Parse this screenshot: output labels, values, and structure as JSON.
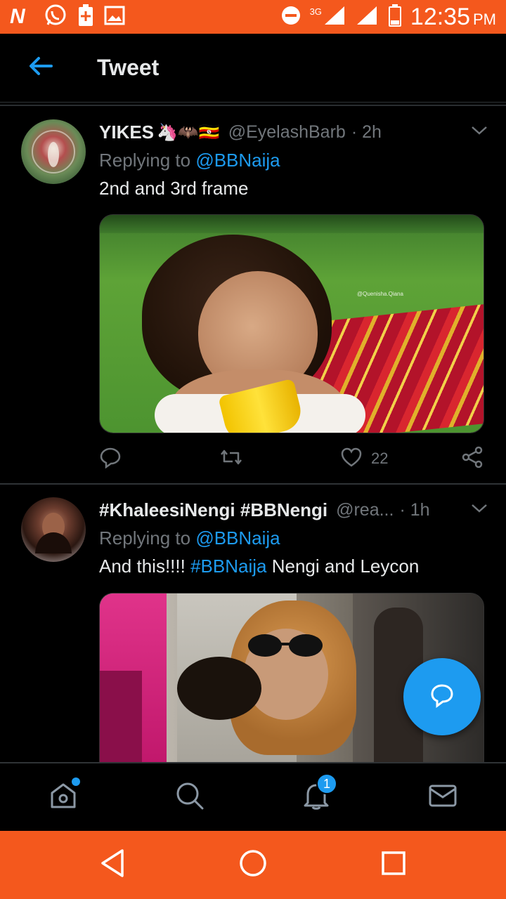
{
  "status_bar": {
    "time": "12:35",
    "ampm": "PM",
    "network": "3G",
    "icons": [
      "n-app-icon",
      "whatsapp-icon",
      "battery-saver-icon",
      "gallery-icon",
      "dnd-icon",
      "signal-icon",
      "signal-icon",
      "battery-icon"
    ]
  },
  "header": {
    "title": "Tweet"
  },
  "tweets": [
    {
      "name": "YIKES",
      "emoji": "🦄🦇🇺🇬",
      "handle": "@EyelashBarb",
      "time": "· 2h",
      "reply_prefix": "Replying to ",
      "reply_to": "@BBNaija",
      "text": "2nd and 3rd frame",
      "media_watermark": "@Quenisha.Qiana",
      "likes": "22"
    },
    {
      "name": "#KhaleesiNengi #BBNengi",
      "handle": "@rea...",
      "time": "· 1h",
      "reply_prefix": "Replying to ",
      "reply_to": "@BBNaija",
      "text_before": "And this!!!! ",
      "hashtag": "#BBNaija",
      "text_after": " Nengi and Leycon"
    }
  ],
  "bottom_nav": {
    "notifications_badge": "1"
  },
  "colors": {
    "accent": "#1d9bf0",
    "status_bar": "#f4581d",
    "background": "#000000",
    "muted_text": "#71767b"
  }
}
